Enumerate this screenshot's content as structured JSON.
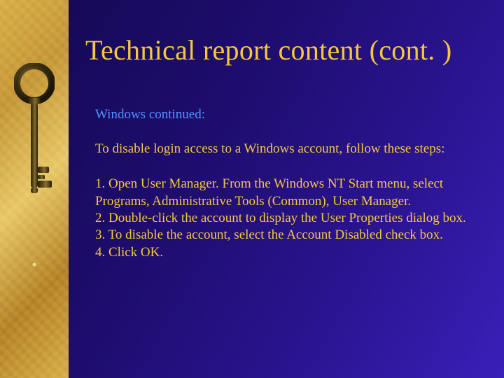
{
  "title": "Technical report content (cont. )",
  "subheading": "Windows continued:",
  "intro": "To disable login access to a Windows account, follow these steps:",
  "steps": [
    "1. Open User Manager. From the Windows NT Start menu, select Programs, Administrative Tools (Common), User Manager.",
    "2. Double-click the account to display the User Properties dialog box.",
    "3. To disable the account, select the Account Disabled check box.",
    "4. Click OK."
  ]
}
